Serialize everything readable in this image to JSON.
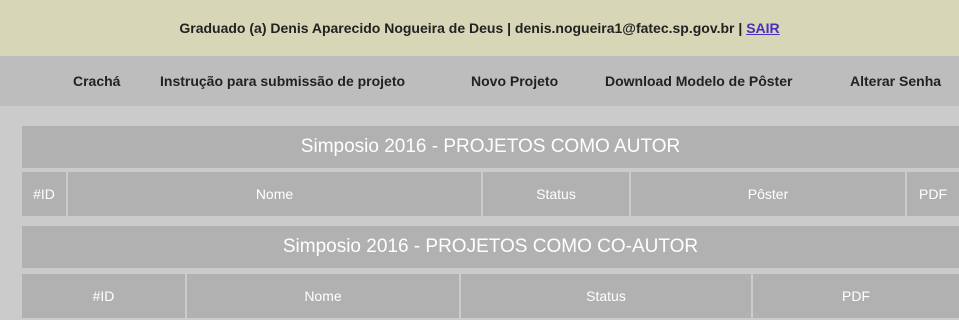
{
  "header": {
    "user_text": "Graduado (a) Denis Aparecido Nogueira de Deus | denis.nogueira1@fatec.sp.gov.br | ",
    "logout_label": "SAIR"
  },
  "nav": {
    "items": [
      {
        "label": "Crachá"
      },
      {
        "label": "Instrução para submissão de projeto"
      },
      {
        "label": "Novo Projeto"
      },
      {
        "label": "Download Modelo de Pôster"
      },
      {
        "label": "Alterar Senha"
      }
    ]
  },
  "author_table": {
    "title": "Simposio 2016 - PROJETOS COMO AUTOR",
    "columns": [
      "#ID",
      "Nome",
      "Status",
      "Pôster",
      "PDF"
    ]
  },
  "coauthor_table": {
    "title": "Simposio 2016 - PROJETOS COMO CO-AUTOR",
    "columns": [
      "#ID",
      "Nome",
      "Status",
      "PDF"
    ]
  }
}
